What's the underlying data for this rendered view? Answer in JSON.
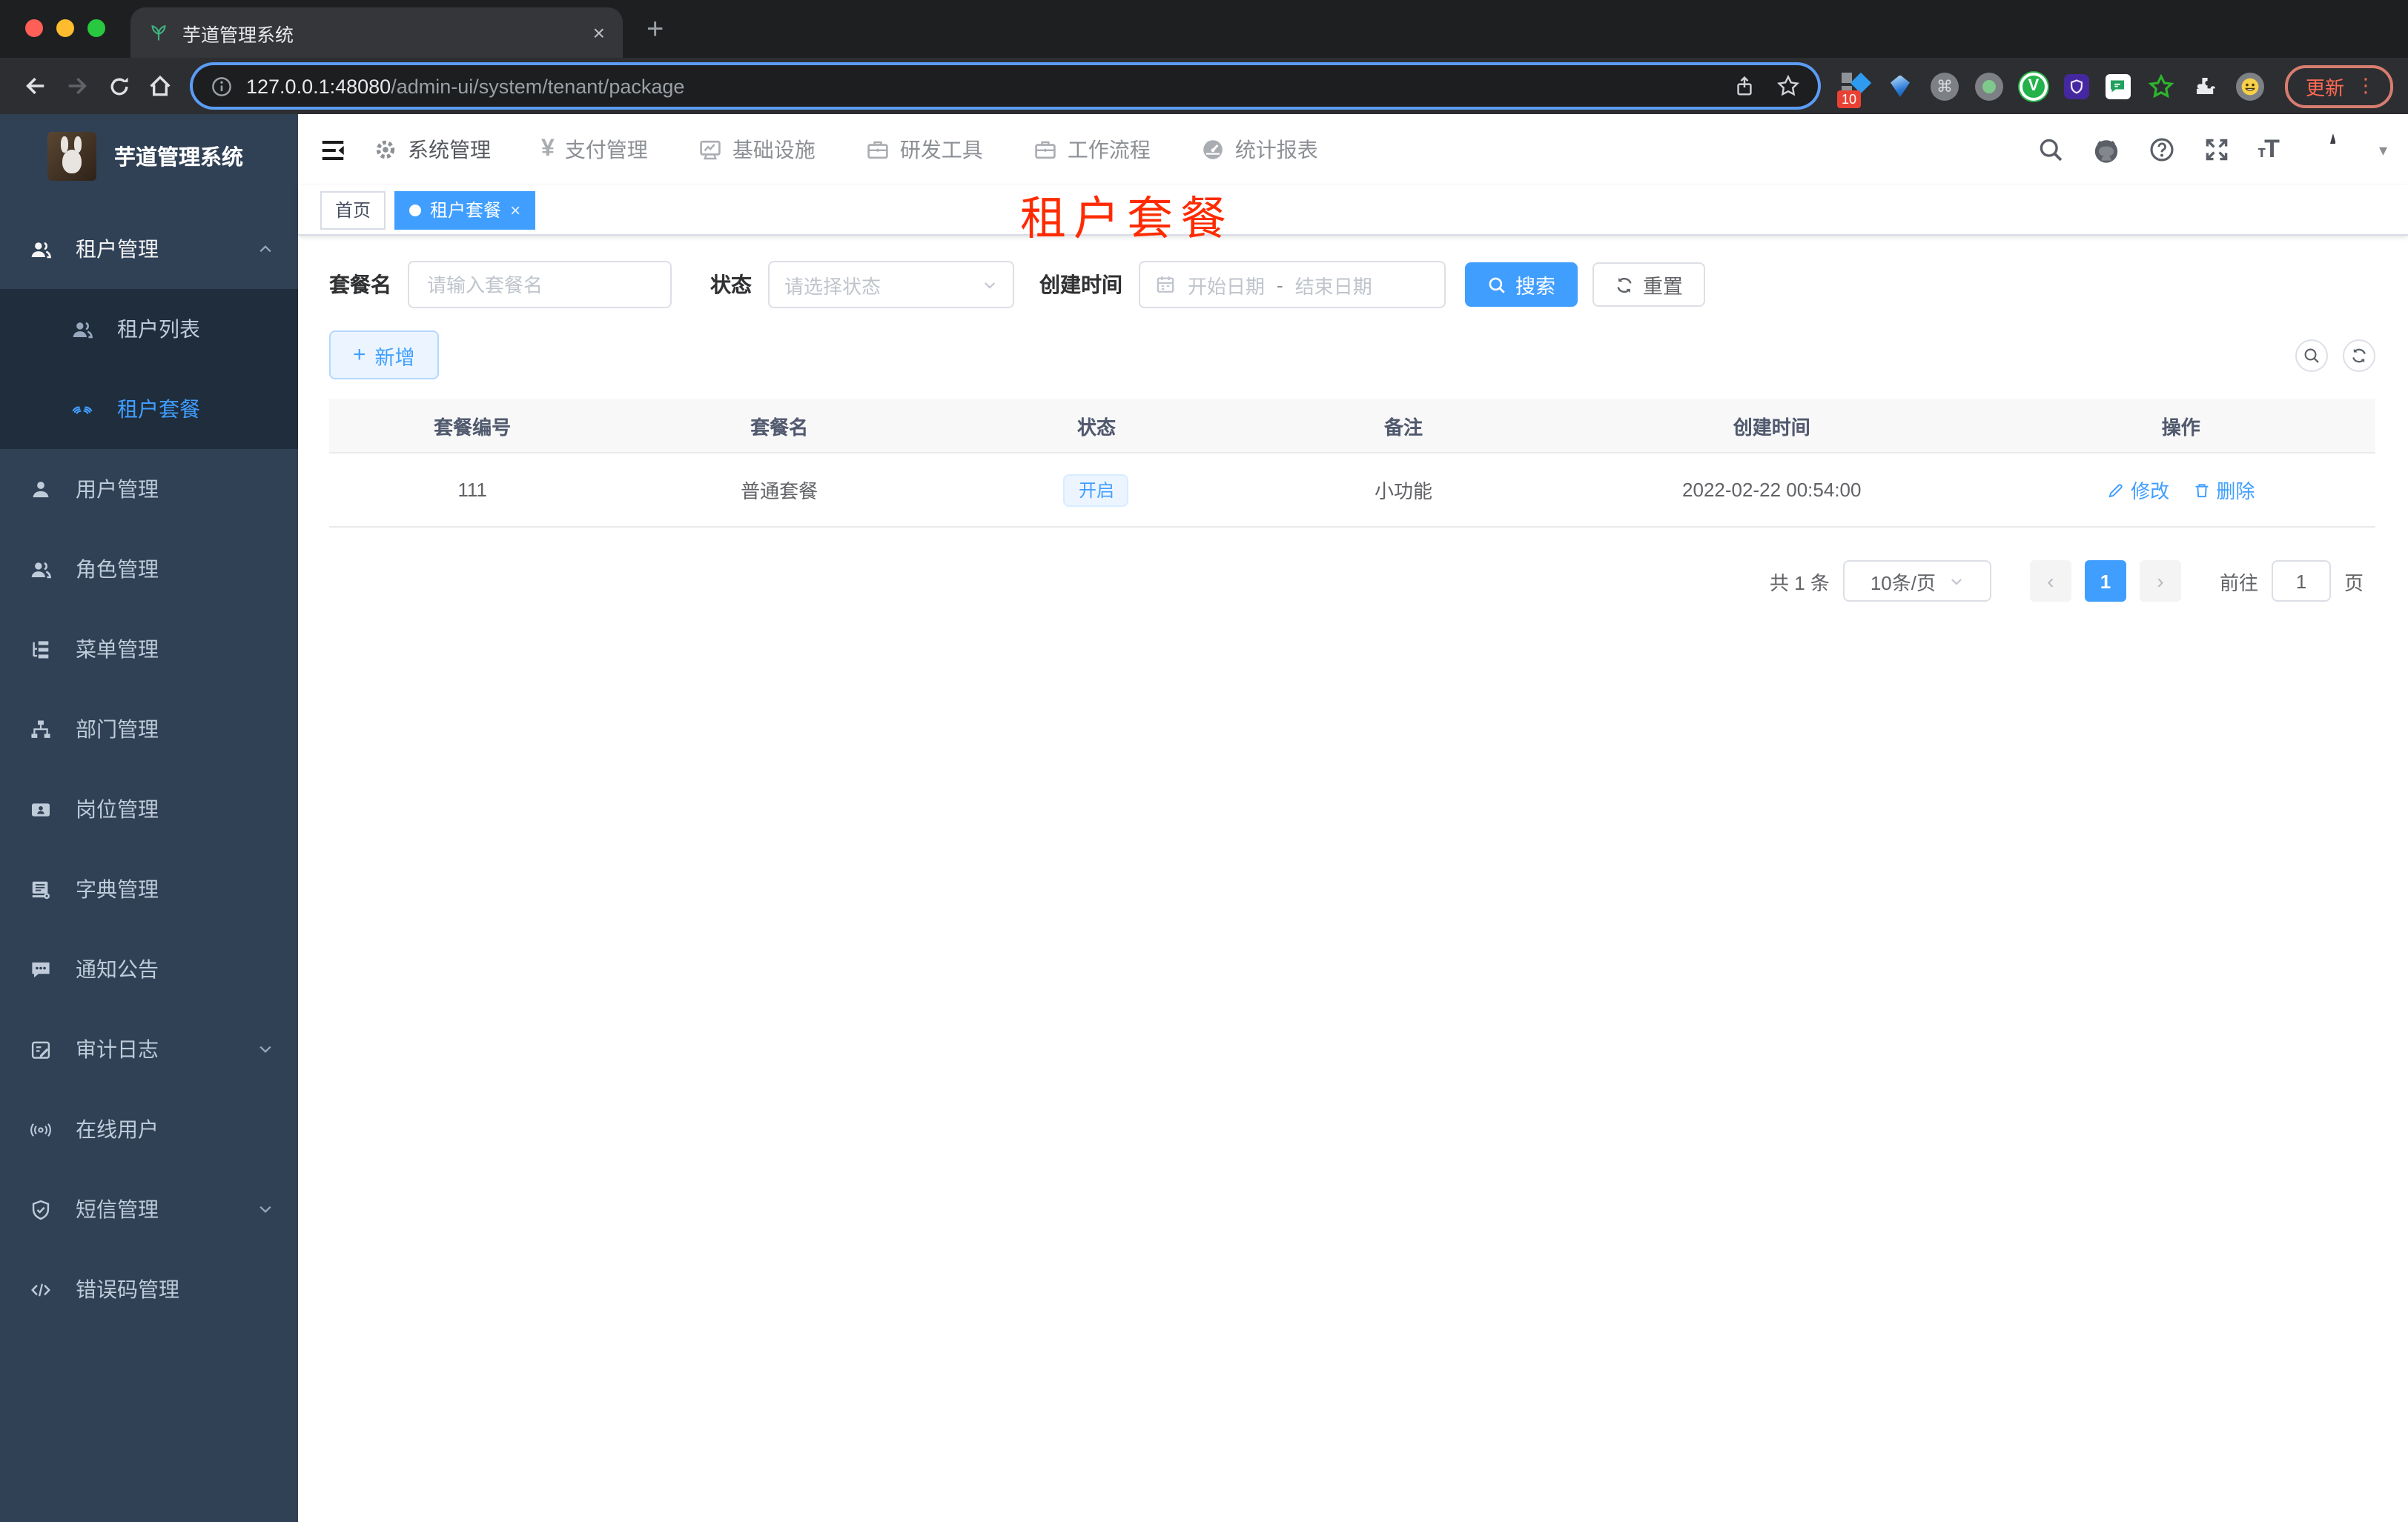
{
  "colors": {
    "accent": "#409eff",
    "sidebar_bg": "#304156",
    "submenu_bg": "#1f2d3d",
    "annotation_red": "#fe2b00"
  },
  "browser": {
    "tab_title": "芋道管理系统",
    "url_host": "127.0.0.1:48080",
    "url_path": "/admin-ui/system/tenant/package",
    "extension_badge": "10",
    "update_label": "更新",
    "extensions": [
      "grid-diamond-icon",
      "gem-icon",
      "command-icon",
      "record-icon",
      "v-green-icon",
      "shield-purple-icon",
      "chat-green-icon",
      "star-green-icon",
      "puzzle-icon",
      "emoji-face-icon"
    ]
  },
  "sidebar": {
    "app_title": "芋道管理系统",
    "items": [
      {
        "label": "租户管理",
        "icon": "users-icon",
        "state": "expanded",
        "children": [
          {
            "label": "租户列表",
            "icon": "users-icon"
          },
          {
            "label": "租户套餐",
            "icon": "package-icon",
            "active": true
          }
        ]
      },
      {
        "label": "用户管理",
        "icon": "user-icon"
      },
      {
        "label": "角色管理",
        "icon": "roles-icon"
      },
      {
        "label": "菜单管理",
        "icon": "menu-tree-icon"
      },
      {
        "label": "部门管理",
        "icon": "org-chart-icon"
      },
      {
        "label": "岗位管理",
        "icon": "post-badge-icon"
      },
      {
        "label": "字典管理",
        "icon": "dictionary-icon"
      },
      {
        "label": "通知公告",
        "icon": "notice-icon"
      },
      {
        "label": "审计日志",
        "icon": "audit-log-icon",
        "state": "collapsed"
      },
      {
        "label": "在线用户",
        "icon": "online-user-icon"
      },
      {
        "label": "短信管理",
        "icon": "shield-check-icon",
        "state": "collapsed"
      },
      {
        "label": "错误码管理",
        "icon": "code-icon"
      }
    ]
  },
  "topnav": {
    "items": [
      {
        "label": "系统管理",
        "icon": "gear-icon",
        "active": true
      },
      {
        "label": "支付管理",
        "icon": "yen-icon"
      },
      {
        "label": "基础设施",
        "icon": "monitor-icon"
      },
      {
        "label": "研发工具",
        "icon": "briefcase-icon"
      },
      {
        "label": "工作流程",
        "icon": "briefcase-icon"
      },
      {
        "label": "统计报表",
        "icon": "gauge-icon"
      }
    ]
  },
  "tags": {
    "home": "首页",
    "current": "租户套餐"
  },
  "annotation_title": "租户套餐",
  "filters": {
    "name_label": "套餐名",
    "name_placeholder": "请输入套餐名",
    "status_label": "状态",
    "status_placeholder": "请选择状态",
    "date_label": "创建时间",
    "date_start": "开始日期",
    "date_sep": "-",
    "date_end": "结束日期",
    "search_label": "搜索",
    "reset_label": "重置"
  },
  "toolbar": {
    "add_label": "新增"
  },
  "table": {
    "headers": [
      "套餐编号",
      "套餐名",
      "状态",
      "备注",
      "创建时间",
      "操作"
    ],
    "rows": [
      {
        "id": "111",
        "name": "普通套餐",
        "status": "开启",
        "remark": "小功能",
        "created_at": "2022-02-22 00:54:00",
        "action_edit": "修改",
        "action_delete": "删除"
      }
    ]
  },
  "pagination": {
    "total": "共 1 条",
    "page_size": "10条/页",
    "current_page": "1",
    "goto_label": "前往",
    "goto_value": "1",
    "page_unit": "页"
  }
}
